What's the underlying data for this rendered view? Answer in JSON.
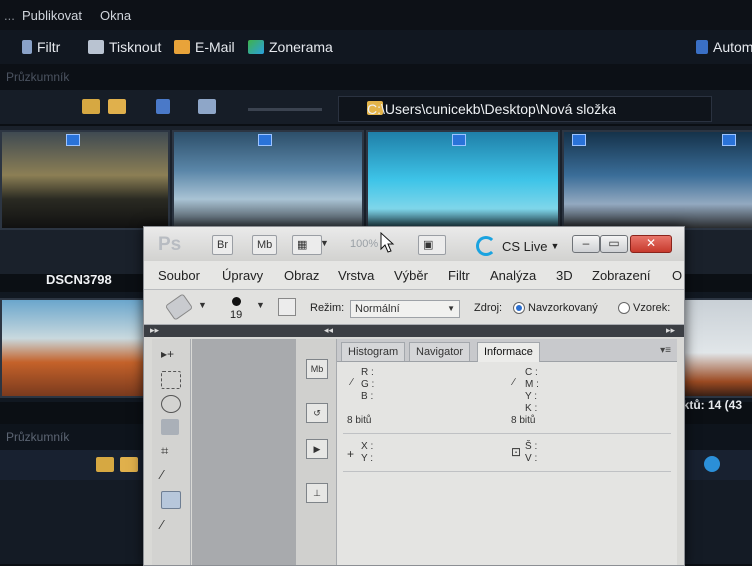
{
  "bridge": {
    "menu": [
      "Publikovat",
      "Okna"
    ],
    "menu_partial": "...",
    "toolbar": {
      "filtr": "Filtr",
      "tisknout": "Tisknout",
      "email": "E-Mail",
      "zonerama": "Zonerama",
      "auto": "Autom"
    },
    "path": "C:\\Users\\cunicekb\\Desktop\\Nová složka",
    "thumb_label": "DSCN3798",
    "status": "ektů: 14 (43",
    "panel_title": "Průzkumník"
  },
  "photoshop": {
    "logo": "Ps",
    "title_buttons": {
      "br": "Br",
      "mb": "Mb"
    },
    "zoom": "100%",
    "cslive": "CS Live",
    "menu": [
      "Soubor",
      "Úpravy",
      "Obraz",
      "Vrstva",
      "Výběr",
      "Filtr",
      "Analýza",
      "3D",
      "Zobrazení",
      "O"
    ],
    "options": {
      "brush_size": "19",
      "mode_label": "Režim:",
      "mode_value": "Normální",
      "source_label": "Zdroj:",
      "source_sampled": "Navzorkovaný",
      "source_pattern": "Vzorek:"
    },
    "panel": {
      "tabs": [
        "Histogram",
        "Navigator",
        "Informace"
      ],
      "active_tab": 2,
      "info_left": {
        "r": "R :",
        "g": "G :",
        "b": "B :",
        "bits": "8 bitů",
        "x": "X :",
        "y": "Y :"
      },
      "info_right": {
        "c": "C :",
        "m": "M :",
        "y": "Y :",
        "k": "K :",
        "bits": "8 bitů",
        "w": "Š :",
        "v": "V :"
      }
    },
    "dock_labels": {
      "mb": "Mb"
    }
  },
  "colors": {
    "close": "#c73a2d",
    "accent": "#1aa3e0"
  }
}
